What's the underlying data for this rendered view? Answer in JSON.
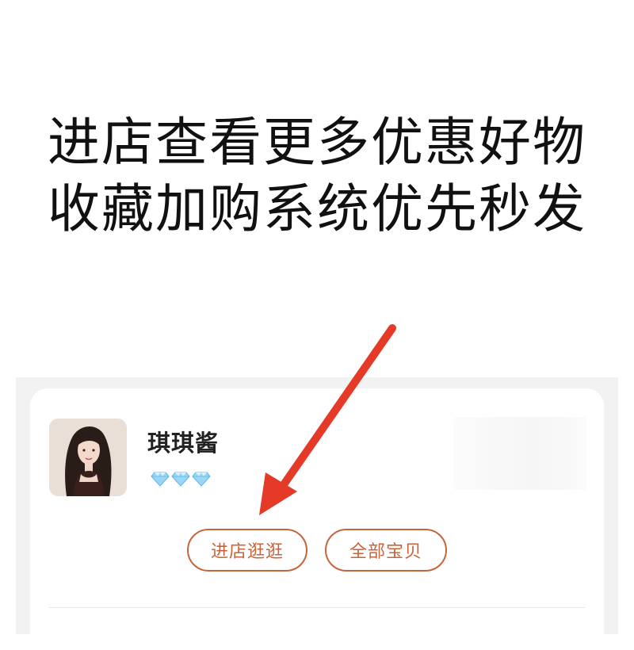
{
  "promo": {
    "line1": "进店查看更多优惠好物",
    "line2": "收藏加购系统优先秒发"
  },
  "shop": {
    "name": "琪琪酱",
    "diamond_icon": "diamond-icon",
    "diamond_count": 3,
    "visit_label": "进店逛逛",
    "all_items_label": "全部宝贝"
  },
  "colors": {
    "accent": "#c8643a",
    "arrow": "#e53a28",
    "diamond": "#8fd0f4"
  }
}
